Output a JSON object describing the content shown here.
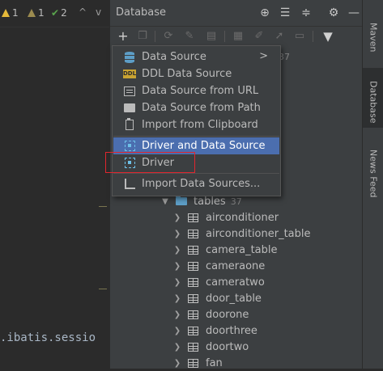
{
  "editor": {
    "inspections": {
      "warnings": "1",
      "weak_warnings": "1",
      "typos": "2",
      "nav_up": "^",
      "nav_down": "v"
    },
    "code_line": ".ibatis.sessio"
  },
  "panel": {
    "title": "Database",
    "title_icons": [
      "add-circle-icon",
      "expand-all-icon",
      "collapse-all-icon",
      "gear-icon",
      "minimize-icon"
    ],
    "toolbar_icons": [
      "add-icon",
      "copy-icon",
      "refresh-icon",
      "schema-icon",
      "database-icon",
      "table-icon",
      "edit-icon",
      "jump-icon",
      "console-icon",
      "filter-icon"
    ],
    "hidden_count": "37",
    "tree": {
      "folder": {
        "label": "tables",
        "count": "37"
      },
      "tables": [
        "airconditioner",
        "airconditioner_table",
        "camera_table",
        "cameraone",
        "cameratwo",
        "door_table",
        "doorone",
        "doorthree",
        "doortwo",
        "fan"
      ]
    }
  },
  "menu": {
    "items": [
      {
        "label": "Data Source",
        "icon": "database-icon",
        "has_submenu": true
      },
      {
        "label": "DDL Data Source",
        "icon": "ddl-icon",
        "icon_text": "DDL"
      },
      {
        "label": "Data Source from URL",
        "icon": "url-icon"
      },
      {
        "label": "Data Source from Path",
        "icon": "folder-icon"
      },
      {
        "label": "Import from Clipboard",
        "icon": "clipboard-icon"
      },
      {
        "label": "Driver and Data Source",
        "icon": "driver-icon",
        "selected": true
      },
      {
        "label": "Driver",
        "icon": "driver-icon",
        "highlighted_box": true
      },
      {
        "label": "Import Data Sources...",
        "icon": "import-icon"
      }
    ],
    "submenu_arrow": ">"
  },
  "tool_strip": {
    "tabs": [
      {
        "label": "Maven",
        "icon": "maven-icon"
      },
      {
        "label": "Database",
        "icon": "database-icon",
        "active": true
      },
      {
        "label": "News Feed",
        "icon": "news-icon"
      }
    ]
  },
  "colors": {
    "editor_bg": "#2b2b2b",
    "panel_bg": "#3c3f41",
    "selection": "#4b6eaf",
    "highlight_box": "#e0262e",
    "folder": "#5d9ec7",
    "driver_icon": "#6ec1e8"
  }
}
